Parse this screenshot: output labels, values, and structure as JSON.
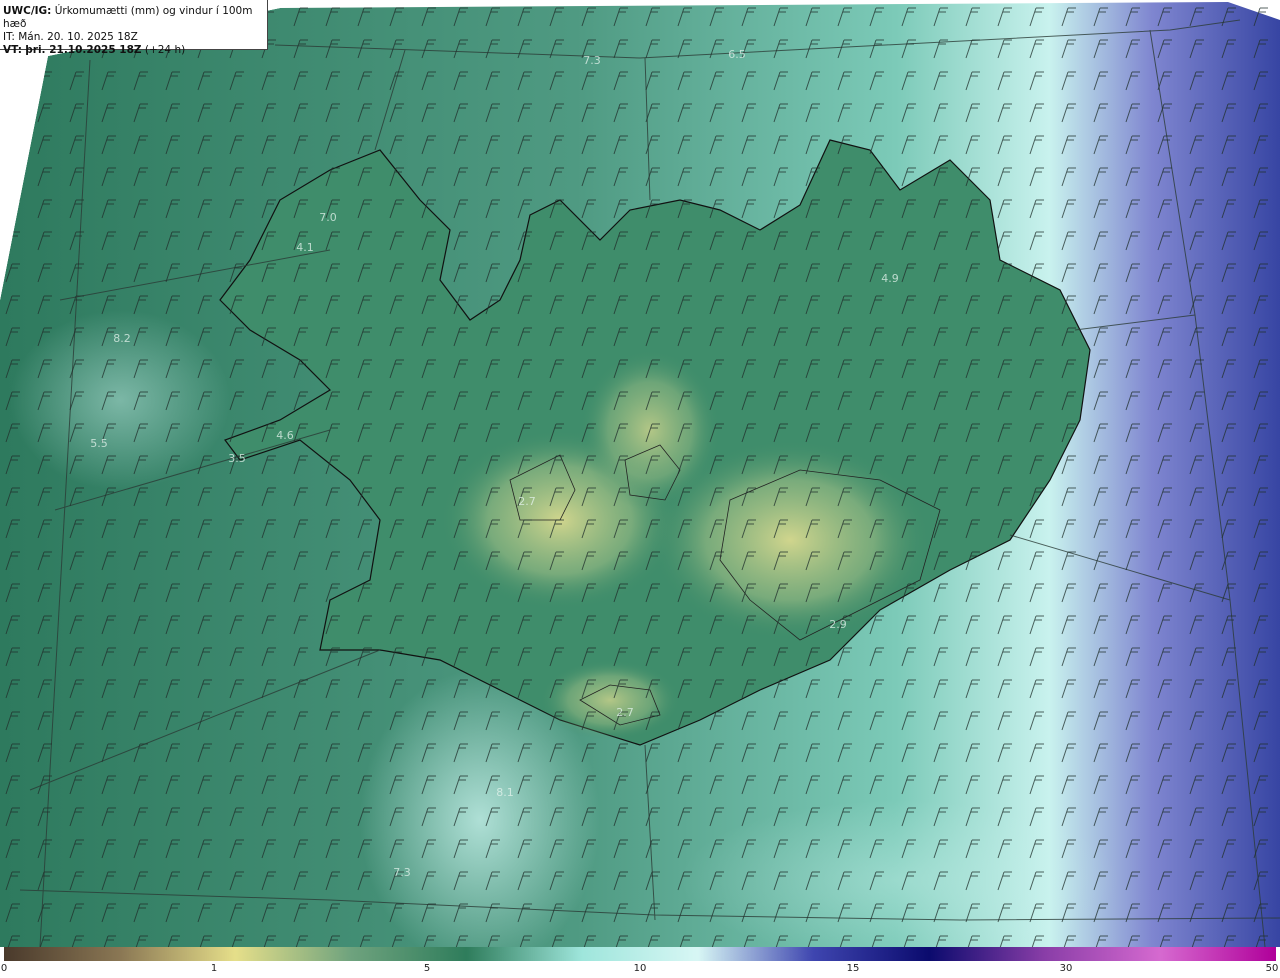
{
  "header": {
    "model": "UWC/IG:",
    "product": "Úrkomumætti (mm) og vindur í 100m hæð",
    "init_label": "IT:",
    "init_time": "Mán. 20. 10. 2025 18Z",
    "valid_label": "VT:",
    "valid_time": "þri. 21.10.2025 18Z",
    "lead": "(+24 h)"
  },
  "colorbar": {
    "ticks": [
      "0",
      "1",
      "5",
      "10",
      "15",
      "30",
      "50"
    ],
    "colors": [
      "#4a3a2c",
      "#8a7754",
      "#e6df8a",
      "#6fa37e",
      "#2f7d5c",
      "#9fe6dc",
      "#d8f7f5",
      "#3f46b0",
      "#0b0b6e",
      "#8a3ea8",
      "#d66ad0",
      "#b0009a"
    ]
  },
  "map_labels": [
    "7.3",
    "6.5",
    "7.0",
    "4.1",
    "8.2",
    "4.9",
    "5.5",
    "3.5",
    "4.6",
    "2.7",
    "2.9",
    "2.7",
    "8.1",
    "7.3"
  ],
  "colors": {
    "land_low": "#2f7d5c",
    "land_high": "#d7d88c",
    "sea_pale": "#bfeee8",
    "sea_deep": "#3b4aa6"
  }
}
